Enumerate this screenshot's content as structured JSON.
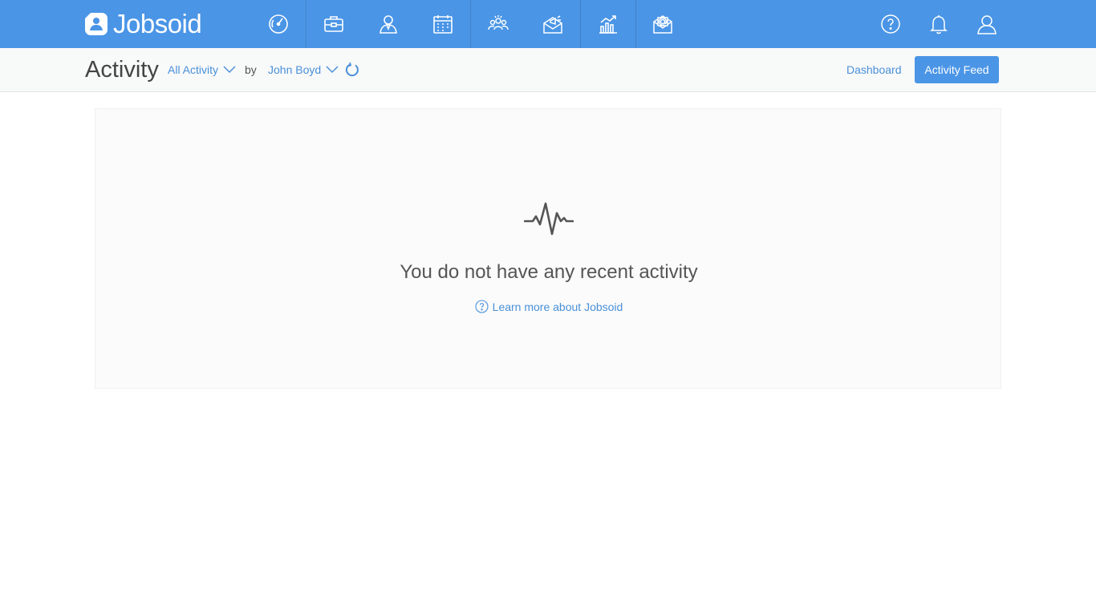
{
  "app": {
    "name": "Jobsoid"
  },
  "nav": {
    "icons": [
      "dashboard-icon",
      "jobs-icon",
      "candidates-icon",
      "calendar-icon",
      "team-icon",
      "campaigns-icon",
      "reports-icon",
      "mail-icon"
    ],
    "right_icons": [
      "help-icon",
      "bell-icon",
      "user-icon"
    ]
  },
  "subheader": {
    "title": "Activity",
    "filter_activity": "All Activity",
    "by_label": "by",
    "filter_user": "John Boyd",
    "dashboard_link": "Dashboard",
    "activity_feed_button": "Activity Feed"
  },
  "empty_state": {
    "icon": "pulse-icon",
    "message": "You do not have any recent activity",
    "learn_more": "Learn more about Jobsoid"
  },
  "colors": {
    "primary": "#4a95e6",
    "link": "#4a90d9",
    "text": "#444444"
  }
}
